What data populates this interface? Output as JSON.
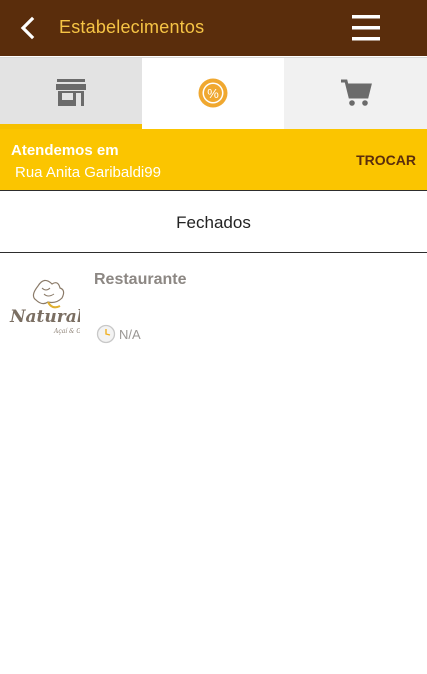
{
  "header": {
    "title": "Estabelecimentos",
    "back_icon": "chevron-left-icon",
    "menu_icon": "hamburger-menu-icon"
  },
  "tabs": [
    {
      "icon": "store-icon",
      "active": true
    },
    {
      "icon": "discount-badge-icon",
      "active": false
    },
    {
      "icon": "cart-icon",
      "active": false
    }
  ],
  "address": {
    "label": "Atendemos em",
    "value": "Rua Anita Garibaldi99",
    "change_label": "TROCAR"
  },
  "section": {
    "title": "Fechados"
  },
  "stores": [
    {
      "name": "Restaurante",
      "logo_text": "Naturalis",
      "logo_subtext": "Açaí & Grill",
      "hours": "N/A"
    }
  ],
  "colors": {
    "header_bg": "#5a2d0c",
    "accent_yellow": "#fbc500",
    "title_text": "#f6c445",
    "tab_bg": "#f1f1f1"
  }
}
